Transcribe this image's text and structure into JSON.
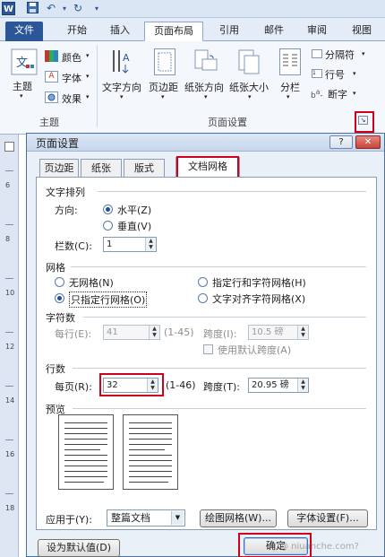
{
  "ribbon": {
    "app_badge": "W",
    "tabs": [
      {
        "label": "文件"
      },
      {
        "label": "开始"
      },
      {
        "label": "插入"
      },
      {
        "label": "页面布局"
      },
      {
        "label": "引用"
      },
      {
        "label": "邮件"
      },
      {
        "label": "审阅"
      },
      {
        "label": "视图"
      }
    ],
    "theme_group": {
      "theme_label": "主题",
      "colors_label": "颜色",
      "fonts_label": "字体",
      "effects_label": "效果",
      "group_name": "主题"
    },
    "page_setup_group": {
      "items": [
        "文字方向",
        "页边距",
        "纸张方向",
        "纸张大小",
        "分栏"
      ],
      "breaks_label": "分隔符",
      "line_numbers_label": "行号",
      "hyphenation_label": "断字",
      "group_name": "页面设置"
    }
  },
  "ruler": {
    "numbers": [
      "6",
      "8",
      "10",
      "12",
      "14",
      "16",
      "18"
    ]
  },
  "dialog": {
    "title": "页面设置",
    "help": "?",
    "close": "✕",
    "tabs": [
      "页边距",
      "纸张",
      "版式",
      "文档网格"
    ],
    "text_direction": {
      "section": "文字排列",
      "direction_label": "方向:",
      "horizontal": "水平(Z)",
      "vertical": "垂直(V)",
      "columns_label": "栏数(C):",
      "columns_value": "1"
    },
    "grid": {
      "section": "网格",
      "options": [
        "无网格(N)",
        "指定行和字符网格(H)",
        "只指定行网格(O)",
        "文字对齐字符网格(X)"
      ]
    },
    "characters": {
      "section": "字符数",
      "per_line_label": "每行(E):",
      "per_line_value": "41",
      "per_line_range": "(1-45)",
      "pitch_label": "跨度(I):",
      "pitch_value": "10.5 磅",
      "default_pitch_label": "使用默认跨度(A)"
    },
    "lines": {
      "section": "行数",
      "per_page_label": "每页(R):",
      "per_page_value": "32",
      "per_page_range": "(1-46)",
      "pitch_label": "跨度(T):",
      "pitch_value": "20.95 磅"
    },
    "preview": {
      "section": "预览"
    },
    "apply_to": {
      "label": "应用于(Y):",
      "value": "整篇文档",
      "draw_grid_button": "绘图网格(W)...",
      "font_settings_button": "字体设置(F)..."
    },
    "set_default_button": "设为默认值(D)",
    "ok_button": "确定",
    "watermark": "@ niuanche.com?"
  },
  "colors": {
    "accent": "#2b5797",
    "highlight": "#d0021b"
  }
}
